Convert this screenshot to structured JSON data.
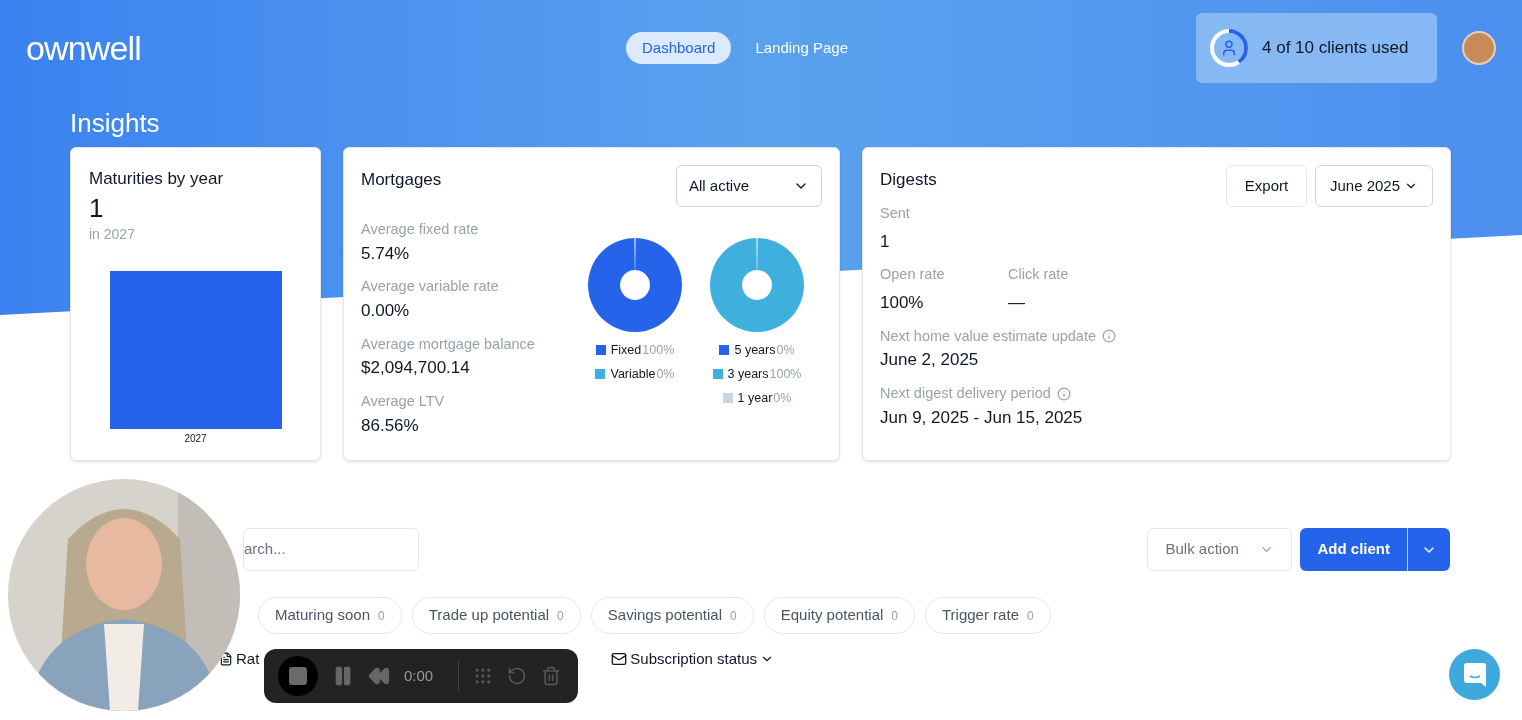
{
  "header": {
    "logo": "ownwell",
    "nav": [
      {
        "label": "Dashboard",
        "selected": true
      },
      {
        "label": "Landing Page",
        "selected": false
      }
    ],
    "usage": {
      "text": "4 of 10 clients used",
      "level": 0.4
    }
  },
  "title": "Insights",
  "maturities": {
    "title": "Maturities by year",
    "count": "1",
    "subtitle": "in 2027",
    "bar_label": "2027"
  },
  "mortgages": {
    "title": "Mortgages",
    "filter": "All active",
    "stats": [
      {
        "label": "Average fixed rate",
        "value": "5.74%"
      },
      {
        "label": "Average variable rate",
        "value": "0.00%"
      },
      {
        "label": "Average mortgage balance",
        "value": "$2,094,700.14"
      },
      {
        "label": "Average LTV",
        "value": "86.56%"
      }
    ],
    "donuts": [
      {
        "color": "#2563eb",
        "legend": [
          {
            "label": "Fixed",
            "share": "100%",
            "color": "#2563eb"
          },
          {
            "label": "Variable",
            "share": "0%",
            "color": "#3fb0de"
          }
        ]
      },
      {
        "color": "#3fb0de",
        "legend": [
          {
            "label": "5 years",
            "share": "0%",
            "color": "#2563eb"
          },
          {
            "label": "3 years",
            "share": "100%",
            "color": "#3fb0de"
          },
          {
            "label": "1 year",
            "share": "0%",
            "color": "#cbd5e1"
          }
        ]
      }
    ]
  },
  "digests": {
    "title": "Digests",
    "export": "Export",
    "period": "June 2025",
    "sent": {
      "label": "Sent",
      "value": "1"
    },
    "rates": [
      {
        "label": "Open rate",
        "value": "100%"
      },
      {
        "label": "Click rate",
        "value": "—"
      }
    ],
    "dates": [
      {
        "label": "Next home value estimate update",
        "value": "June 2, 2025"
      },
      {
        "label": "Next digest delivery period",
        "value": "Jun 9, 2025 - Jun 15, 2025"
      }
    ]
  },
  "clients": {
    "search_placeholder": "arch...",
    "bulk_action": "Bulk action",
    "add_client": "Add client",
    "chips": [
      {
        "label": "Maturing soon",
        "count": "0"
      },
      {
        "label": "Trade up potential",
        "count": "0"
      },
      {
        "label": "Savings potential",
        "count": "0"
      },
      {
        "label": "Equity potential",
        "count": "0"
      },
      {
        "label": "Trigger rate",
        "count": "0"
      }
    ],
    "filters": [
      {
        "label": "Rat",
        "kind": "rate"
      },
      {
        "label": "Subscription status",
        "kind": "mail"
      }
    ]
  },
  "recorder": {
    "time": "0:00"
  }
}
